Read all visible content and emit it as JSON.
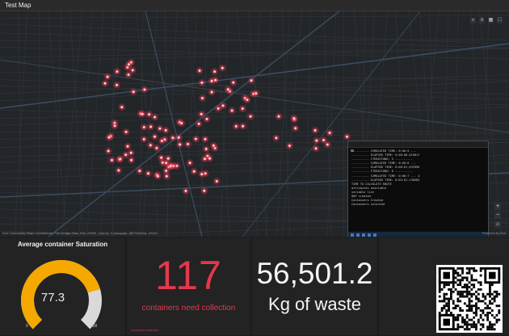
{
  "app": {
    "title": "Test Map"
  },
  "map": {
    "attribution": "Esri Community Maps Contributors, Fort Dodge Atlas, Esri, HERE, Garmin, Foursquare, METI/NASA, USGS",
    "powered_by": "Powered by Esri",
    "tools": [
      "search-icon",
      "layers-icon",
      "basemap-icon",
      "fullscreen-icon"
    ],
    "controls": [
      "+",
      "−",
      "⌂"
    ],
    "hotspot_color": "#ff3b52"
  },
  "console": {
    "lines": [
      "---------- SIMULATED TIME: 0:00:5 ---",
      "---------- ELAPSED TIME: 0:00:00.019017",
      "---------- ITERATIONS: 5 ----------",
      "---------- SIMULATED TIME: 0:00:6 ---",
      "---------- ELAPSED TIME: 0:00:01.033996",
      "---------- ITERATIONS: 6 ----------",
      "---------- SIMULATED TIME: 0:00:7 --- 4",
      "---------- ELAPSED TIME: 0:03:01.138585",
      "TIME TO CALCULATE ROUTE",
      "attributes available",
      "variable list",
      "HOP created",
      "Containers Created",
      "Containers selected"
    ]
  },
  "dashboard": {
    "gauge": {
      "title": "Average container Saturation",
      "value": 77.3,
      "value_text": "77.3",
      "min": "0",
      "max": "100",
      "fill_color": "#f5a800",
      "track_color": "#d9d9d9"
    },
    "containers": {
      "count": "117",
      "caption": "containers need collection",
      "note": "containers selected",
      "color": "#e2394b"
    },
    "waste": {
      "value": "56,501.2",
      "caption": "Kg of waste"
    }
  }
}
